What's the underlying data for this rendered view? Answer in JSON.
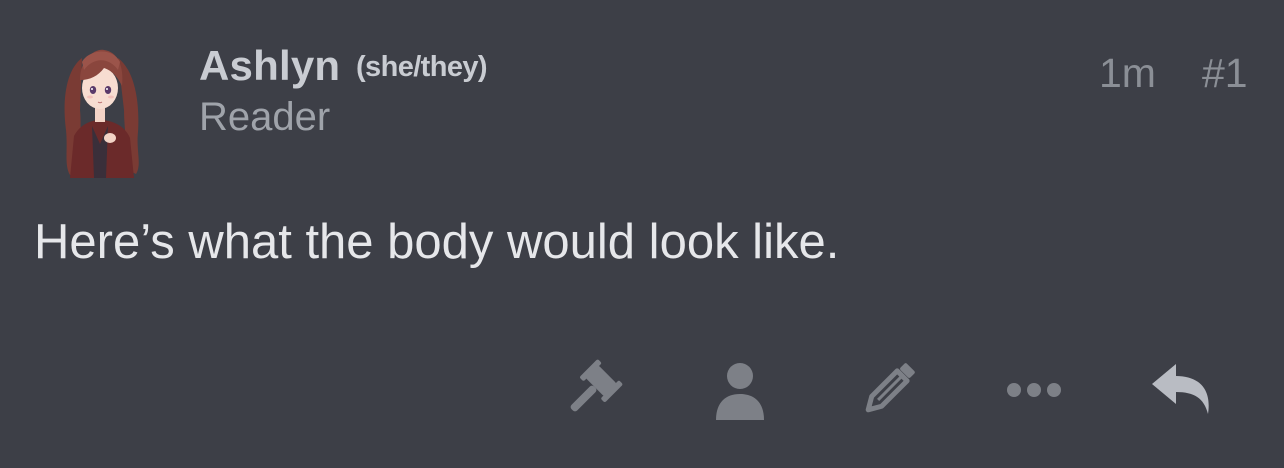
{
  "post": {
    "author": {
      "name": "Ashlyn",
      "pronouns": "(she/they)",
      "role": "Reader",
      "avatar_icon": "anime-girl-avatar"
    },
    "time_ago": "1m",
    "post_number": "#1",
    "body": "Here’s what the body would look like."
  },
  "actions": [
    {
      "name": "moderate",
      "icon": "gavel-icon"
    },
    {
      "name": "profile",
      "icon": "user-icon"
    },
    {
      "name": "edit",
      "icon": "pencil-icon"
    },
    {
      "name": "more",
      "icon": "ellipsis-icon"
    },
    {
      "name": "reply",
      "icon": "reply-icon"
    }
  ],
  "colors": {
    "background": "#3d3f47",
    "icon_muted": "#7d8087",
    "reply_icon": "#b9bcc3",
    "text_primary": "#e6e7ea",
    "text_secondary": "#9fa3aa"
  }
}
